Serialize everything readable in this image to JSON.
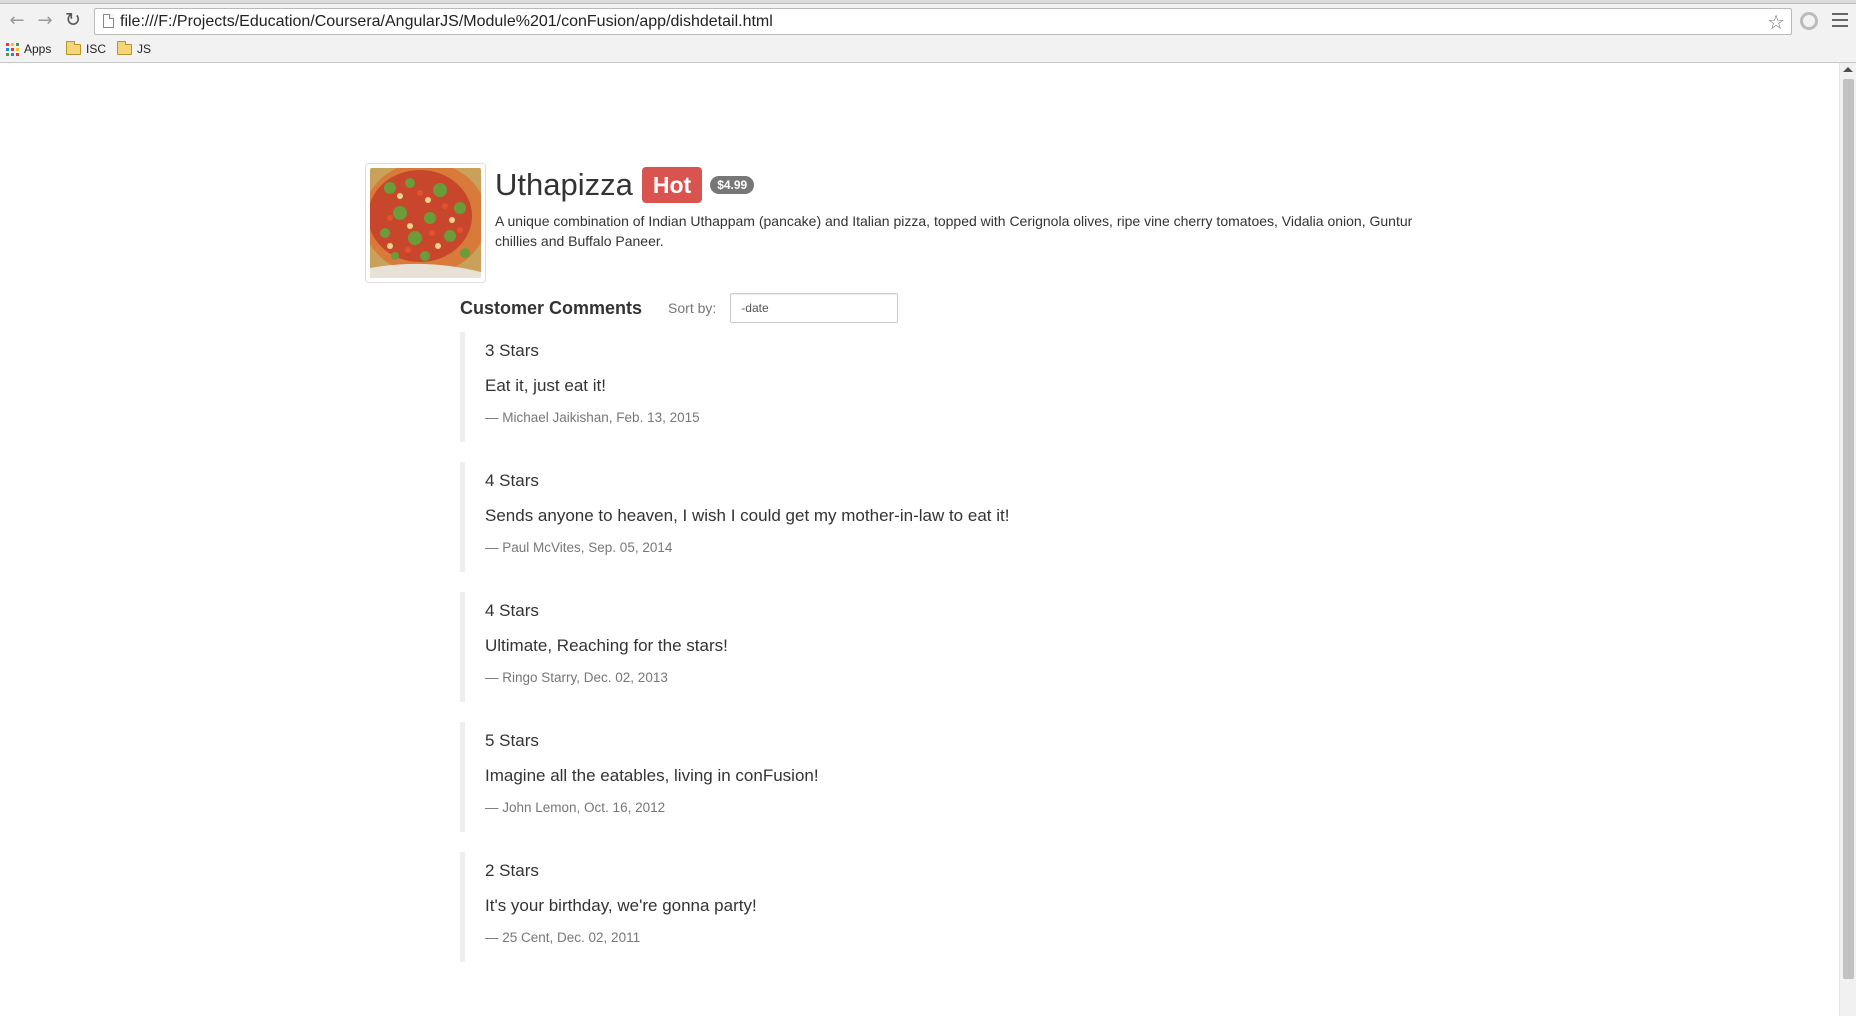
{
  "browser": {
    "url": "file:///F:/Projects/Education/Coursera/AngularJS/Module%201/conFusion/app/dishdetail.html",
    "bookmarks": [
      {
        "label": "Apps",
        "icon": "apps-grid-icon"
      },
      {
        "label": "ISC",
        "icon": "folder-icon"
      },
      {
        "label": "JS",
        "icon": "folder-icon"
      }
    ]
  },
  "dish": {
    "name": "Uthapizza",
    "label": "Hot",
    "price": "$4.99",
    "description": "A unique combination of Indian Uthappam (pancake) and Italian pizza, topped with Cerignola olives, ripe vine cherry tomatoes, Vidalia onion, Guntur chillies and Buffalo Paneer.",
    "image": "pizza-photo"
  },
  "comments_section": {
    "title": "Customer Comments",
    "sort_label": "Sort by:",
    "sort_value": "-date"
  },
  "comments": [
    {
      "rating": "3 Stars",
      "text": "Eat it, just eat it!",
      "footer": "— Michael Jaikishan, Feb. 13, 2015"
    },
    {
      "rating": "4 Stars",
      "text": "Sends anyone to heaven, I wish I could get my mother-in-law to eat it!",
      "footer": "— Paul McVites, Sep. 05, 2014"
    },
    {
      "rating": "4 Stars",
      "text": "Ultimate, Reaching for the stars!",
      "footer": "— Ringo Starry, Dec. 02, 2013"
    },
    {
      "rating": "5 Stars",
      "text": "Imagine all the eatables, living in conFusion!",
      "footer": "— John Lemon, Oct. 16, 2012"
    },
    {
      "rating": "2 Stars",
      "text": "It's your birthday, we're gonna party!",
      "footer": "— 25 Cent, Dec. 02, 2011"
    }
  ],
  "colors": {
    "label_danger": "#d9534f",
    "badge": "#777777",
    "blockquote_border": "#eeeeee"
  }
}
